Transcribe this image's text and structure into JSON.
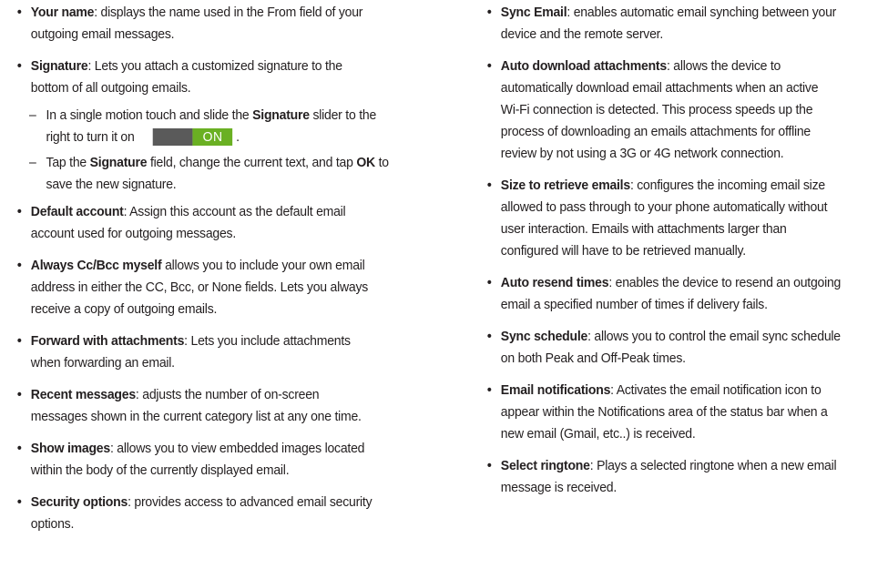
{
  "left": [
    {
      "term": "Your name",
      "text": ": displays the name used in the From field of your",
      "cont": "outgoing email messages."
    },
    {
      "term": "Signature",
      "text": ": Lets you attach a customized signature to the",
      "cont": "bottom of all outgoing emails."
    },
    {
      "sub1_a": "In a single motion touch and slide the ",
      "sub1_b": "Signature",
      "sub1_c": " slider to the",
      "sub1_d": "right to turn it on",
      "toggle_label": "ON",
      "sub1_e": ".",
      "sub2_a": "Tap the ",
      "sub2_b": "Signature",
      "sub2_c": " field, change the current text, and tap ",
      "sub2_d": "OK",
      "sub2_e": " to",
      "sub2_f": "save the new signature."
    },
    {
      "term": "Default account",
      "text": ": Assign this account as the default email",
      "cont": "account used for outgoing messages."
    },
    {
      "term": "Always Cc/Bcc myself",
      "text": " allows you to include your own email",
      "cont": "address in either the CC, Bcc, or None fields. Lets you always",
      "cont2": "receive a copy of outgoing emails."
    },
    {
      "term": "Forward with attachments",
      "text": ": Lets you include attachments",
      "cont": "when forwarding an email."
    },
    {
      "term": "Recent messages",
      "text": ": adjusts the number of on-screen",
      "cont": "messages shown in the current category list at any one time."
    },
    {
      "term": "Show images",
      "text": ": allows you to view embedded images located",
      "cont": "within the body of the currently displayed email."
    },
    {
      "term": "Security options",
      "text": ": provides access to advanced email security",
      "cont": "options."
    }
  ],
  "right": [
    {
      "term": "Sync Email",
      "text": ": enables automatic email synching between your",
      "cont": "device and the remote server."
    },
    {
      "term": "Auto download attachments",
      "text": ": allows the device to",
      "cont": "automatically download email attachments when an active",
      "cont2": "Wi-Fi connection is detected. This process speeds up the",
      "cont3": "process of downloading an emails attachments for offline",
      "cont4": "review by not using a 3G or 4G network connection."
    },
    {
      "term": "Size to retrieve emails",
      "text": ": configures the incoming email size",
      "cont": "allowed to pass through to your phone automatically without",
      "cont2": "user interaction. Emails with attachments larger than",
      "cont3": "configured will have to be retrieved manually."
    },
    {
      "term": "Auto resend times",
      "text": ": enables the device to resend an outgoing",
      "cont": "email a specified number of times if delivery fails."
    },
    {
      "term": "Sync schedule",
      "text": ": allows you to control the email sync schedule",
      "cont": "on both Peak and Off-Peak times."
    },
    {
      "term": "Email notifications",
      "text": ": Activates the email notification icon to",
      "cont": "appear within the Notifications area of the status bar when a",
      "cont2": "new email (Gmail, etc..) is received."
    },
    {
      "term": "Select ringtone",
      "text": ": Plays a selected ringtone when a new email",
      "cont": "message is received."
    }
  ],
  "colors": {
    "text": "#231f20",
    "toggle_off": "#5a5a5a",
    "toggle_on": "#6ab023"
  }
}
